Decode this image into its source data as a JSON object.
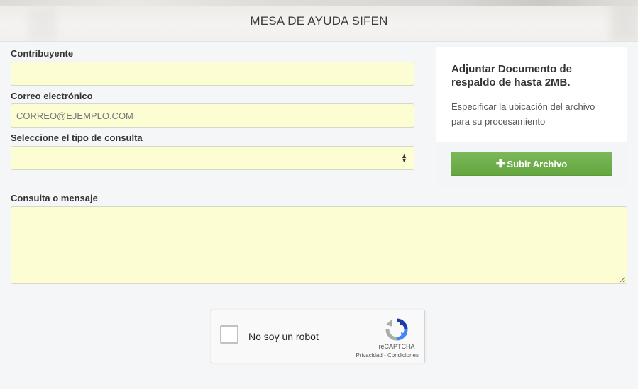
{
  "header": {
    "title": "MESA DE AYUDA SIFEN"
  },
  "form": {
    "contribuyente_label": "Contribuyente",
    "contribuyente_value": "",
    "email_label": "Correo electrónico",
    "email_placeholder": "CORREO@EJEMPLO.COM",
    "tipo_label": "Seleccione el tipo de consulta",
    "tipo_value": "",
    "mensaje_label": "Consulta o mensaje",
    "mensaje_value": ""
  },
  "panel": {
    "title": "Adjuntar Documento de respaldo de hasta 2MB.",
    "description": "Especificar la ubicación del archivo para su procesamiento",
    "upload_label": "Subir Archivo",
    "upload_icon": "plus-icon",
    "upload_color": "#6aad46"
  },
  "captcha": {
    "label": "No soy un robot",
    "brand": "reCAPTCHA",
    "privacy": "Privacidad",
    "separator": "-",
    "terms": "Condiciones"
  },
  "colors": {
    "field_background": "#fdfdd3",
    "page_background": "#f5f6f8"
  }
}
